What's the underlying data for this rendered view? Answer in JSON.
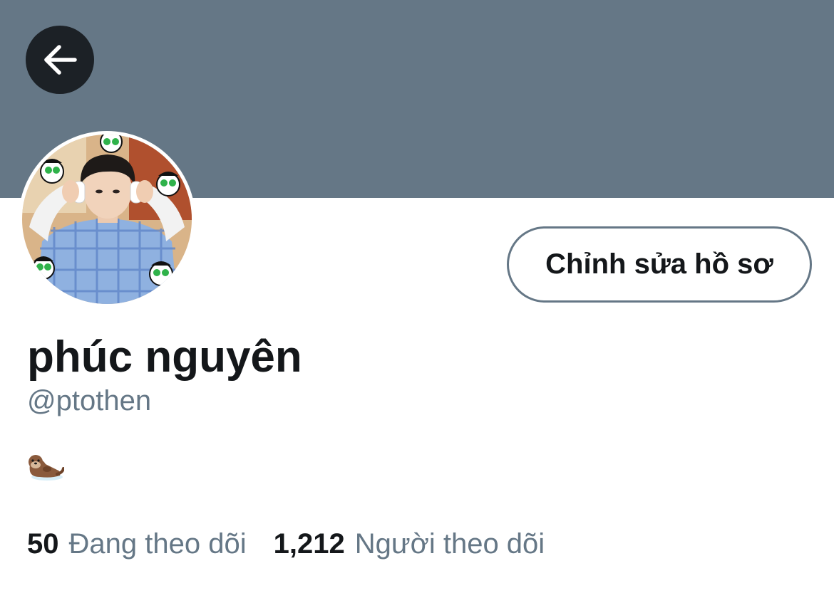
{
  "colors": {
    "banner": "#657786",
    "back_button_bg": "#1c2126",
    "primary_text": "#14171a",
    "secondary_text": "#657786",
    "button_border": "#657786"
  },
  "header": {
    "back_icon": "arrow-left-icon"
  },
  "profile": {
    "avatar_icon": "profile-photo",
    "edit_button_label": "Chỉnh sửa hồ sơ",
    "display_name": "phúc nguyên",
    "handle": "@ptothen",
    "bio_icon": "otter-emoji"
  },
  "stats": {
    "following_count": "50",
    "following_label": "Đang theo dõi",
    "followers_count": "1,212",
    "followers_label": "Người theo dõi"
  }
}
